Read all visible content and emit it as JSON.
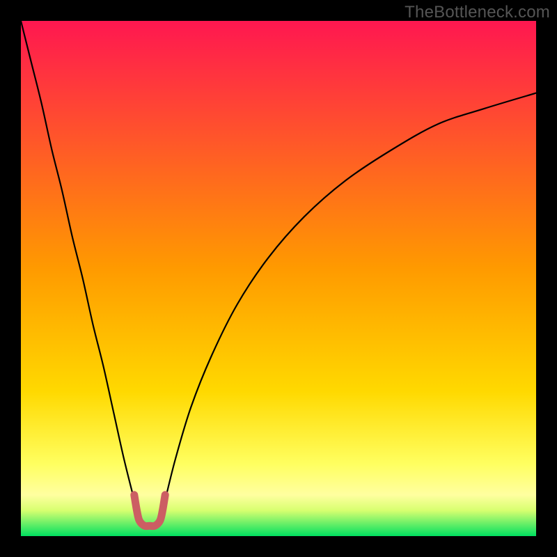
{
  "watermark": "TheBottleneck.com",
  "chart_data": {
    "type": "line",
    "title": "",
    "xlabel": "",
    "ylabel": "",
    "xlim": [
      0,
      100
    ],
    "ylim": [
      0,
      100
    ],
    "background_gradient": {
      "top": "#ff1750",
      "mid": "#ffd900",
      "band": "#ffff80",
      "bottom": "#00e060"
    },
    "series": [
      {
        "name": "left-branch",
        "x": [
          0,
          2,
          4,
          6,
          8,
          10,
          12,
          14,
          16,
          18,
          20,
          22,
          23
        ],
        "values": [
          100,
          92,
          84,
          75,
          67,
          58,
          50,
          41,
          33,
          24,
          15,
          7,
          3
        ]
      },
      {
        "name": "right-branch",
        "x": [
          27,
          28,
          30,
          33,
          37,
          42,
          48,
          55,
          63,
          72,
          81,
          90,
          100
        ],
        "values": [
          3,
          7,
          15,
          25,
          35,
          45,
          54,
          62,
          69,
          75,
          80,
          83,
          86
        ]
      },
      {
        "name": "valley-marker",
        "x": [
          22,
          22.5,
          23,
          24,
          25,
          26,
          27,
          27.5,
          28
        ],
        "values": [
          8,
          5,
          3,
          2,
          2,
          2,
          3,
          5,
          8
        ]
      }
    ],
    "valley_color": "#cc5e63",
    "curve_color": "#000000"
  }
}
